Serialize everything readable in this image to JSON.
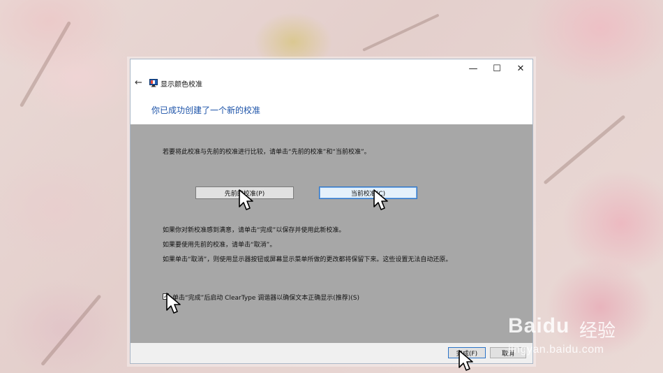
{
  "window": {
    "minimize_glyph": "—",
    "maximize_glyph": "☐",
    "close_glyph": "✕",
    "back_glyph": "←",
    "app_title": "显示颜色校准",
    "app_icon": "monitor-icon"
  },
  "heading": "你已成功创建了一个新的校准",
  "content": {
    "compare_instruction": "若要将此校准与先前的校准进行比较，请单击“先前的校准”和“当前校准”。",
    "previous_button": "先前的校准(P)",
    "current_button": "当前校准(C)",
    "satisfied_text": "如果你对新校准感到满意，请单击“完成”以保存并使用此新校准。",
    "use_previous_text": "如果要使用先前的校准，请单击“取消”。",
    "cancel_note": "如果单击“取消”，则使用显示器按钮或屏幕显示菜单所做的更改都将保留下来。这些设置无法自动还原。",
    "cleartype_checkbox": {
      "label": "单击“完成”后启动 ClearType 调谐器以确保文本正确显示(推荐)(S)",
      "checked": true,
      "check_glyph": "✓"
    }
  },
  "footer": {
    "finish_button": "完成(F)",
    "cancel_button": "取消"
  },
  "watermark": {
    "logo": "Baidu",
    "jingyan": "经验",
    "url": "jingyan.baidu.com"
  },
  "colors": {
    "heading": "#1b52a8",
    "content_bg": "#a7a7a7",
    "footer_bg": "#f0f0f0",
    "focus_border": "#2b74c8"
  }
}
